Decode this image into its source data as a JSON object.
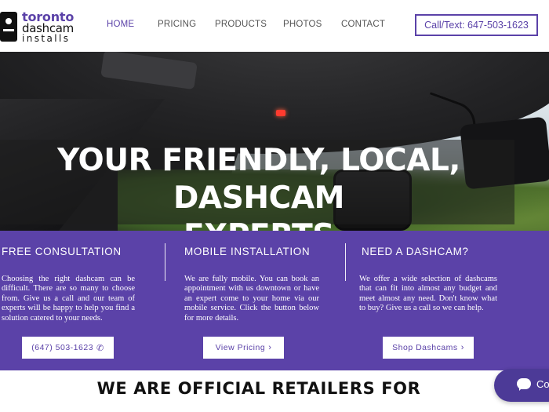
{
  "header": {
    "logo": {
      "line1": "toronto",
      "line2": "dashcam",
      "line3": "installs"
    },
    "nav": [
      {
        "label": "HOME",
        "active": true
      },
      {
        "label": "PRICING",
        "active": false
      },
      {
        "label": "PRODUCTS",
        "active": false
      },
      {
        "label": "PHOTOS",
        "active": false
      },
      {
        "label": "CONTACT",
        "active": false
      }
    ],
    "call_button": "Call/Text: 647-503-1623"
  },
  "hero": {
    "title_line1": "YOUR FRIENDLY, LOCAL, DASHCAM",
    "title_line2": "EXPERTS"
  },
  "features": [
    {
      "title": "FREE CONSULTATION",
      "text": "Choosing the right dashcam can be difficult. There are so many to choose from. Give us a call and our team of experts will be happy to help you find a solution catered to your needs.",
      "button": "(647) 503-1623",
      "button_icon": "phone-icon"
    },
    {
      "title": "MOBILE INSTALLATION",
      "text": "We are fully mobile. You can book an appointment with us downtown or have an expert come to your home via our mobile service. Click the button below for more details.",
      "button": "View Pricing",
      "button_icon": "chevron-right-icon"
    },
    {
      "title": "NEED A DASHCAM?",
      "text": "We offer a wide selection of dashcams that can fit into almost any budget and meet almost any need. Don't know what to buy? Give us a call so we can help.",
      "button": "Shop Dashcams",
      "button_icon": "chevron-right-icon"
    }
  ],
  "retailers": {
    "title": "WE ARE OFFICIAL RETAILERS FOR"
  },
  "chat": {
    "label": "Co"
  },
  "colors": {
    "brand": "#5b42a8",
    "chat": "#4c3a97"
  }
}
